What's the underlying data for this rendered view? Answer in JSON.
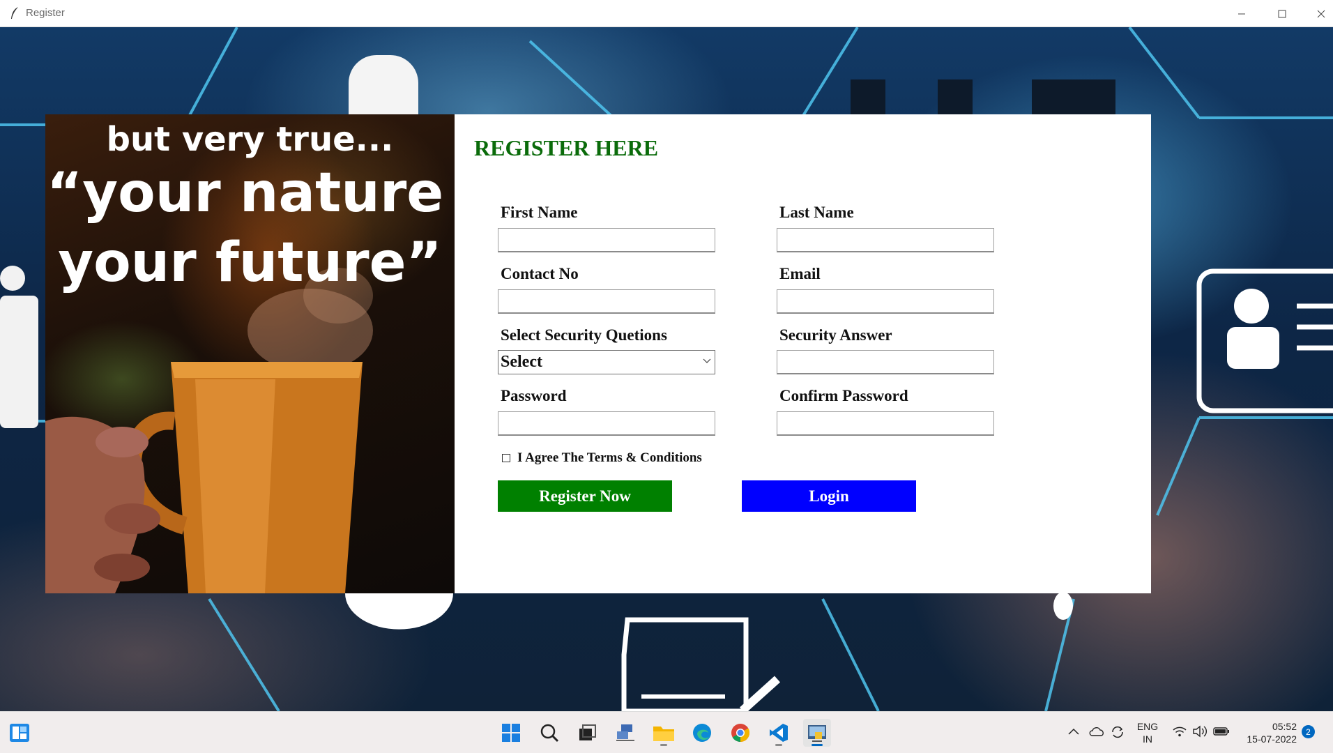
{
  "window": {
    "title": "Register",
    "minimize_icon": "minimize-icon",
    "maximize_icon": "maximize-icon",
    "close_icon": "close-icon"
  },
  "quote": {
    "line1": "but very true...",
    "line2": "“your nature is",
    "line3": "your future”"
  },
  "form": {
    "heading": "REGISTER HERE",
    "first_name_label": "First Name",
    "first_name_value": "",
    "last_name_label": "Last Name",
    "last_name_value": "",
    "contact_label": "Contact No",
    "contact_value": "",
    "email_label": "Email",
    "email_value": "",
    "security_question_label": "Select Security Quetions",
    "security_question_selected": "Select",
    "security_answer_label": "Security Answer",
    "security_answer_value": "",
    "password_label": "Password",
    "password_value": "",
    "confirm_password_label": "Confirm Password",
    "confirm_password_value": "",
    "agree_label": "I Agree The Terms & Conditions",
    "agree_checked": false,
    "register_button": "Register Now",
    "login_button": "Login",
    "colors": {
      "heading": "#0a6b0a",
      "register_button": "#008000",
      "login_button": "#0000ff"
    }
  },
  "taskbar": {
    "apps": [
      "widgets-icon",
      "start-icon",
      "search-icon",
      "task-view-icon",
      "network-app-icon",
      "file-explorer-icon",
      "edge-icon",
      "chrome-icon",
      "vscode-icon",
      "python-app-icon"
    ],
    "language_top": "ENG",
    "language_bottom": "IN",
    "time": "05:52",
    "date": "15-07-2022",
    "notification_count": "2"
  }
}
